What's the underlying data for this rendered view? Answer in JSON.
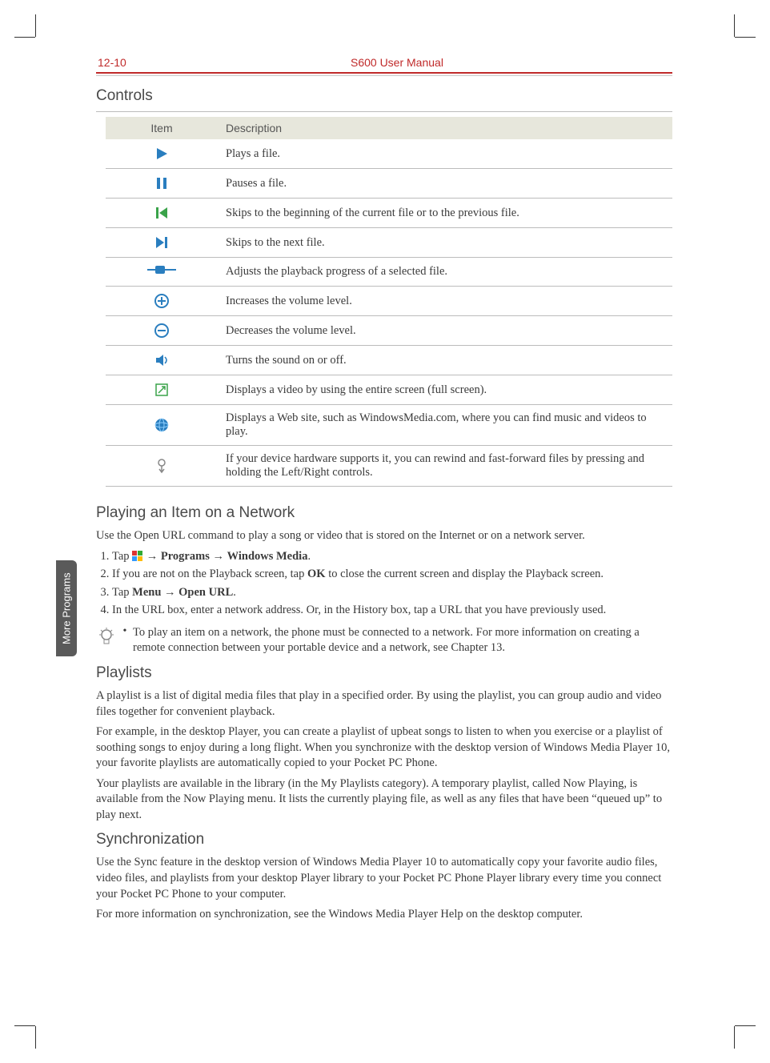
{
  "header": {
    "page_num": "12-10",
    "title": "S600 User Manual"
  },
  "sidetab": "More Programs",
  "sections": {
    "controls_title": "Controls",
    "network_title": "Playing an Item on a Network",
    "playlists_title": "Playlists",
    "sync_title": "Synchronization"
  },
  "controls_table": {
    "head_item": "Item",
    "head_desc": "Description",
    "rows": [
      {
        "icon": "play",
        "desc": "Plays a file."
      },
      {
        "icon": "pause",
        "desc": "Pauses a file."
      },
      {
        "icon": "prev",
        "desc": "Skips to the beginning of the current file or to the previous file."
      },
      {
        "icon": "next",
        "desc": "Skips to the next file."
      },
      {
        "icon": "progress",
        "desc": "Adjusts the playback progress of a selected file."
      },
      {
        "icon": "volup",
        "desc": "Increases the volume level."
      },
      {
        "icon": "voldown",
        "desc": "Decreases the volume level."
      },
      {
        "icon": "mute",
        "desc": "Turns the sound on or off."
      },
      {
        "icon": "fullscreen",
        "desc": "Displays a video by using the entire screen (full screen)."
      },
      {
        "icon": "web",
        "desc": "Displays a Web site, such as WindowsMedia.com, where you can find music and videos to play."
      },
      {
        "icon": "ff",
        "desc": "If your device hardware supports it, you can rewind and fast-forward files by pressing and holding the Left/Right controls."
      }
    ]
  },
  "network": {
    "intro": "Use the Open URL command to play a song or video that is stored on the Internet or on a network server.",
    "step1_pre": "Tap ",
    "step1_mid": " → ",
    "step1_programs": "Programs",
    "step1_arrow2": " → ",
    "step1_wm": "Windows Media",
    "step1_end": ".",
    "step2_pre": "If you are not on the Playback screen, tap ",
    "step2_ok": "OK",
    "step2_post": " to close the current screen and display the Playback screen.",
    "step3_pre": "Tap ",
    "step3_menu": "Menu",
    "step3_arrow": " → ",
    "step3_open": "Open URL",
    "step3_end": ".",
    "step4": "In the URL box, enter a network address. Or, in the History box, tap a URL that you have previously used.",
    "tip": "To play an item on a network, the phone must be connected to a network. For more information on creating a remote connection between your portable device and a network, see Chapter 13."
  },
  "playlists": {
    "p1": "A playlist is a list of digital media files that play in a specified order. By using the playlist, you can group audio and video files together for convenient playback.",
    "p2": "For example, in the desktop Player, you can create a playlist of upbeat songs to listen to when you exercise or a playlist of soothing songs to enjoy during a long flight. When you synchronize with the desktop version of Windows Media Player 10, your favorite playlists are automatically copied to your Pocket PC Phone.",
    "p3": "Your playlists are available in the library (in the My Playlists category). A temporary playlist, called Now Playing, is available from the Now Playing menu. It lists the currently playing file, as well as any files that have been “queued up” to play next."
  },
  "sync": {
    "p1": "Use the Sync feature in the desktop version of Windows Media Player 10 to automatically copy your favorite audio files, video files, and playlists from your desktop Player library to your Pocket PC Phone Player library every time you connect your Pocket PC Phone to your computer.",
    "p2": "For more information on synchronization, see the Windows Media Player Help on the desktop computer."
  }
}
